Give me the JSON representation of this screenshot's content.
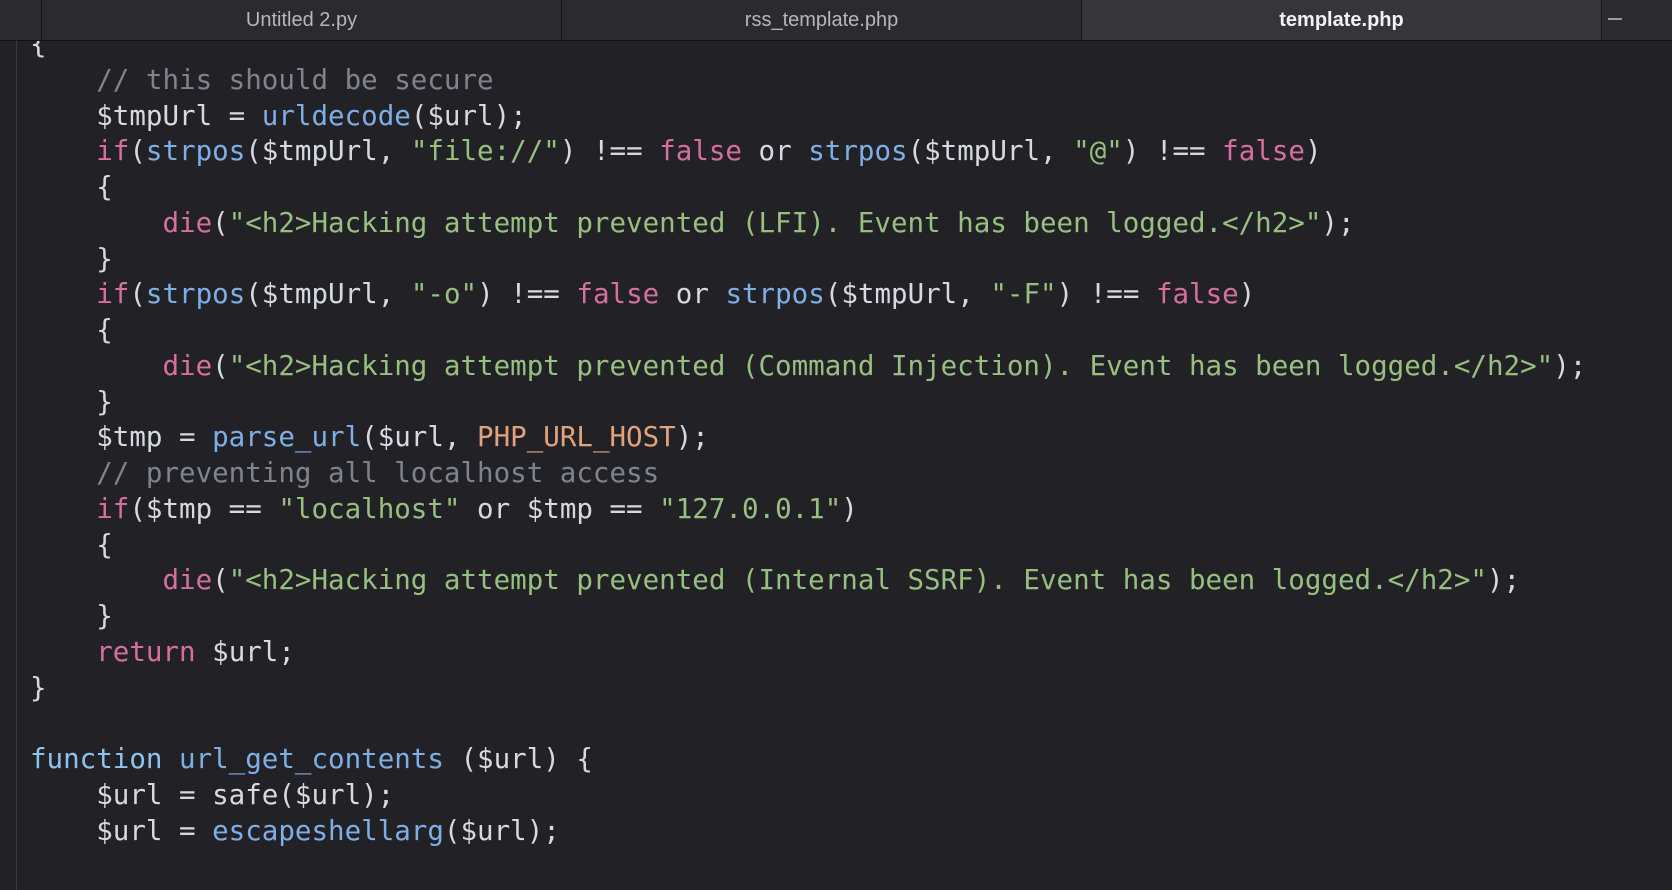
{
  "tabs": [
    {
      "label": "Untitled 2.py",
      "active": false
    },
    {
      "label": "rss_template.php",
      "active": false
    },
    {
      "label": "template.php",
      "active": true
    }
  ],
  "colors": {
    "background": "#222226",
    "keyword": "#d66fa0",
    "function": "#7eaee6",
    "string": "#97c080",
    "comment": "#7d8490",
    "constant": "#e3a27c",
    "plain": "#d7d9de"
  },
  "code": {
    "lines": [
      [
        {
          "t": "plain",
          "v": "{"
        }
      ],
      [
        {
          "t": "comment",
          "v": "    // this should be secure"
        }
      ],
      [
        {
          "t": "plain",
          "v": "    $tmpUrl = "
        },
        {
          "t": "func",
          "v": "urldecode"
        },
        {
          "t": "plain",
          "v": "($url);"
        }
      ],
      [
        {
          "t": "keyword",
          "v": "    if"
        },
        {
          "t": "plain",
          "v": "("
        },
        {
          "t": "func",
          "v": "strpos"
        },
        {
          "t": "plain",
          "v": "($tmpUrl, "
        },
        {
          "t": "string",
          "v": "\"file://\""
        },
        {
          "t": "plain",
          "v": ") !== "
        },
        {
          "t": "keyword",
          "v": "false"
        },
        {
          "t": "plain",
          "v": " or "
        },
        {
          "t": "func",
          "v": "strpos"
        },
        {
          "t": "plain",
          "v": "($tmpUrl, "
        },
        {
          "t": "string",
          "v": "\"@\""
        },
        {
          "t": "plain",
          "v": ") !== "
        },
        {
          "t": "keyword",
          "v": "false"
        },
        {
          "t": "plain",
          "v": ")"
        }
      ],
      [
        {
          "t": "plain",
          "v": "    {"
        }
      ],
      [
        {
          "t": "keyword",
          "v": "        die"
        },
        {
          "t": "plain",
          "v": "("
        },
        {
          "t": "string",
          "v": "\"<h2>Hacking attempt prevented (LFI). Event has been logged.</h2>\""
        },
        {
          "t": "plain",
          "v": ");"
        }
      ],
      [
        {
          "t": "plain",
          "v": "    }"
        }
      ],
      [
        {
          "t": "keyword",
          "v": "    if"
        },
        {
          "t": "plain",
          "v": "("
        },
        {
          "t": "func",
          "v": "strpos"
        },
        {
          "t": "plain",
          "v": "($tmpUrl, "
        },
        {
          "t": "string",
          "v": "\"-o\""
        },
        {
          "t": "plain",
          "v": ") !== "
        },
        {
          "t": "keyword",
          "v": "false"
        },
        {
          "t": "plain",
          "v": " or "
        },
        {
          "t": "func",
          "v": "strpos"
        },
        {
          "t": "plain",
          "v": "($tmpUrl, "
        },
        {
          "t": "string",
          "v": "\"-F\""
        },
        {
          "t": "plain",
          "v": ") !== "
        },
        {
          "t": "keyword",
          "v": "false"
        },
        {
          "t": "plain",
          "v": ")"
        }
      ],
      [
        {
          "t": "plain",
          "v": "    {"
        }
      ],
      [
        {
          "t": "keyword",
          "v": "        die"
        },
        {
          "t": "plain",
          "v": "("
        },
        {
          "t": "string",
          "v": "\"<h2>Hacking attempt prevented (Command Injection). Event has been logged.</h2>\""
        },
        {
          "t": "plain",
          "v": ");"
        }
      ],
      [
        {
          "t": "plain",
          "v": "    }"
        }
      ],
      [
        {
          "t": "plain",
          "v": "    $tmp = "
        },
        {
          "t": "func",
          "v": "parse_url"
        },
        {
          "t": "plain",
          "v": "($url, "
        },
        {
          "t": "const",
          "v": "PHP_URL_HOST"
        },
        {
          "t": "plain",
          "v": ");"
        }
      ],
      [
        {
          "t": "comment",
          "v": "    // preventing all localhost access"
        }
      ],
      [
        {
          "t": "keyword",
          "v": "    if"
        },
        {
          "t": "plain",
          "v": "($tmp == "
        },
        {
          "t": "string",
          "v": "\"localhost\""
        },
        {
          "t": "plain",
          "v": " or $tmp == "
        },
        {
          "t": "string",
          "v": "\"127.0.0.1\""
        },
        {
          "t": "plain",
          "v": ")"
        }
      ],
      [
        {
          "t": "plain",
          "v": "    {"
        }
      ],
      [
        {
          "t": "keyword",
          "v": "        die"
        },
        {
          "t": "plain",
          "v": "("
        },
        {
          "t": "string",
          "v": "\"<h2>Hacking attempt prevented (Internal SSRF). Event has been logged.</h2>\""
        },
        {
          "t": "plain",
          "v": ");"
        }
      ],
      [
        {
          "t": "plain",
          "v": "    }"
        }
      ],
      [
        {
          "t": "keyword",
          "v": "    return"
        },
        {
          "t": "plain",
          "v": " $url;"
        }
      ],
      [
        {
          "t": "plain",
          "v": "}"
        }
      ],
      [],
      [
        {
          "t": "def",
          "v": "function"
        },
        {
          "t": "plain",
          "v": " "
        },
        {
          "t": "func",
          "v": "url_get_contents"
        },
        {
          "t": "plain",
          "v": " ($url) {"
        }
      ],
      [
        {
          "t": "plain",
          "v": "    $url = safe($url);"
        }
      ],
      [
        {
          "t": "plain",
          "v": "    $url = "
        },
        {
          "t": "func",
          "v": "escapeshellarg"
        },
        {
          "t": "plain",
          "v": "($url);"
        }
      ]
    ]
  }
}
